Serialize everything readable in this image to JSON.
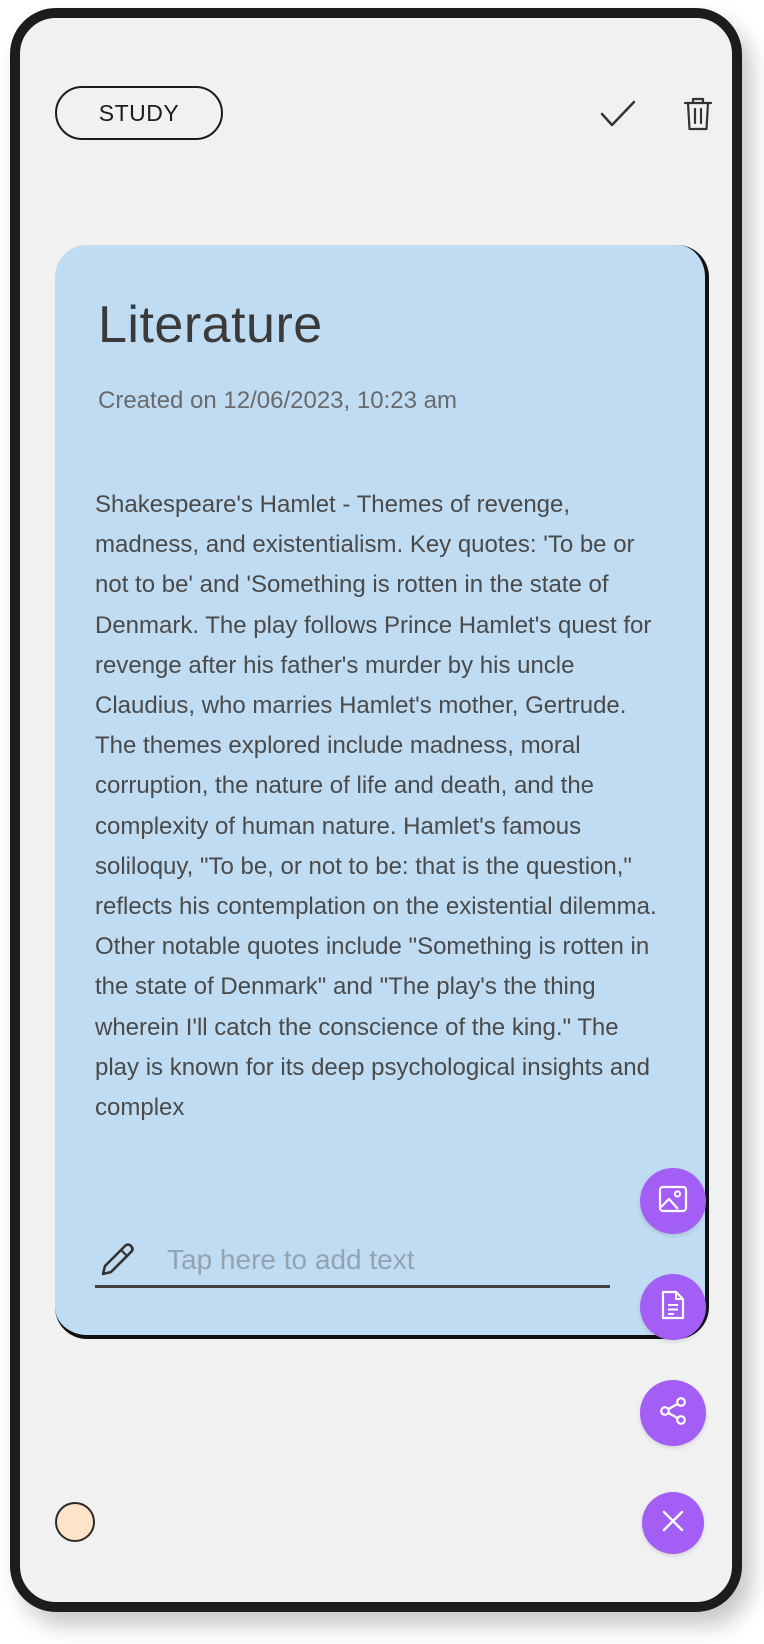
{
  "header": {
    "category_label": "STUDY",
    "icons": {
      "confirm": "check-icon",
      "delete": "trash-icon"
    }
  },
  "note": {
    "title": "Literature",
    "created": "Created on 12/06/2023, 10:23 am",
    "body": "Shakespeare's Hamlet - Themes of revenge, madness, and existentialism.  Key quotes: 'To be or not to be' and 'Something is rotten in the state of Denmark. The play follows Prince Hamlet's quest for revenge after his father's murder by his uncle Claudius, who marries Hamlet's mother, Gertrude. The themes explored include madness, moral corruption, the nature of life and death, and the complexity of human nature. Hamlet's famous soliloquy, \"To be, or not to be: that is the question,\" reflects his contemplation on the existential dilemma. Other notable quotes include \"Something is rotten in the state of Denmark\" and \"The play's the thing wherein I'll catch the conscience of the king.\" The play is known for its deep psychological insights and complex",
    "background_color": "#c0dcf2",
    "add_text": {
      "placeholder": "Tap here to add text",
      "icon": "pencil-icon"
    }
  },
  "actions": {
    "buttons": [
      {
        "icon": "image-icon"
      },
      {
        "icon": "document-icon"
      },
      {
        "icon": "share-icon"
      },
      {
        "icon": "close-icon"
      }
    ],
    "accent_color": "#a35ef5"
  },
  "color_picker": {
    "selected_color": "#fde3c8"
  }
}
